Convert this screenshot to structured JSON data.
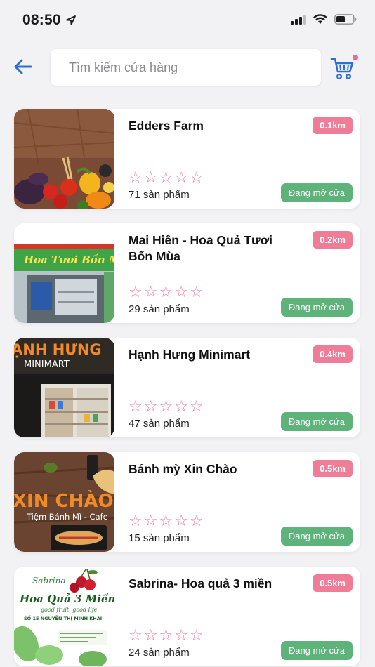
{
  "status_bar": {
    "time": "08:50"
  },
  "header": {
    "search_placeholder": "Tìm kiếm cửa hàng",
    "accent_color": "#2f6fd1",
    "cart_badge_color": "#ef6b8d"
  },
  "colors": {
    "distance_badge": "#ef7d98",
    "open_badge": "#5eb37a",
    "star": "#f07fa0"
  },
  "stores": [
    {
      "name": "Edders Farm",
      "distance": "0.1km",
      "rating": 0,
      "products": "71 sản phẩm",
      "status": "Đang mở cửa"
    },
    {
      "name": "Mai Hiên -  Hoa Quả Tươi Bốn Mùa",
      "distance": "0.2km",
      "rating": 0,
      "products": "29 sản phẩm",
      "status": "Đang mở cửa"
    },
    {
      "name": "Hạnh Hưng Minimart",
      "distance": "0.4km",
      "rating": 0,
      "products": "47 sản phẩm",
      "status": "Đang mở cửa"
    },
    {
      "name": "Bánh mỳ Xin Chào",
      "distance": "0.5km",
      "rating": 0,
      "products": "15 sản phẩm",
      "status": "Đang mở cửa"
    },
    {
      "name": "Sabrina- Hoa quả 3 miền",
      "distance": "0.5km",
      "rating": 0,
      "products": "24 sản phẩm",
      "status": "Đang mở cửa"
    }
  ],
  "thumbnails": {
    "store_2": {
      "sign": "Hoa Tươi Bốn Mùa"
    },
    "store_3": {
      "sign_top": "ẠNH HƯNG",
      "sign_bottom": "MINIMART"
    },
    "store_4": {
      "sign": "XIN CHÀO",
      "sub": "Tiệm Bánh Mì - Cafe"
    },
    "store_5": {
      "script": "Sabrina",
      "title": "Hoa Quả 3 Miền",
      "tagline": "good fruit, good life",
      "address": "SỐ 15 NGUYỄN THỊ MINH KHAI"
    }
  }
}
